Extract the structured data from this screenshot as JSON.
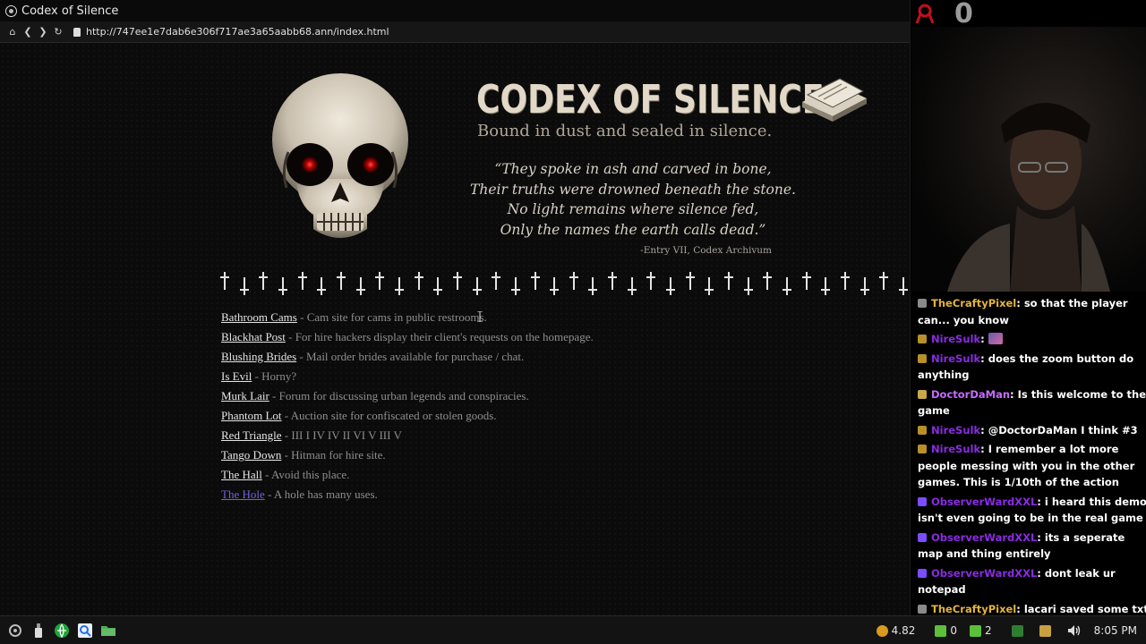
{
  "browser": {
    "window_title": "Codex of Silence",
    "url": "http://747ee1e7dab6e306f717ae3a65aabb68.ann/index.html",
    "nav_icons": [
      "home-icon",
      "back-icon",
      "forward-icon",
      "reload-icon"
    ]
  },
  "page": {
    "title": "CODEX OF SILENCE",
    "subtitle": "Bound in dust and sealed in silence.",
    "poem": [
      "“They spoke in ash and carved in bone,",
      "Their truths were drowned beneath the stone.",
      "No light remains where silence fed,",
      "Only the names the earth calls dead.”"
    ],
    "attribution": "-Entry VII, Codex Archivum",
    "divider_crosses": 36,
    "sites": [
      {
        "name": "Bathroom Cams",
        "desc": " - Cam site for cams in public restrooms.",
        "visited": false
      },
      {
        "name": "Blackhat Post",
        "desc": " - For hire hackers display their client's requests on the homepage.",
        "visited": false
      },
      {
        "name": "Blushing Brides",
        "desc": " - Mail order brides available for purchase / chat.",
        "visited": false
      },
      {
        "name": "Is Evil",
        "desc": " - Horny?",
        "visited": false
      },
      {
        "name": "Murk Lair",
        "desc": " - Forum for discussing urban legends and conspiracies.",
        "visited": false
      },
      {
        "name": "Phantom Lot",
        "desc": " - Auction site for confiscated or stolen goods.",
        "visited": false
      },
      {
        "name": "Red Triangle",
        "desc": " - III I IV IV II VI V III V",
        "visited": false
      },
      {
        "name": "Tango Down",
        "desc": " - Hitman for hire site.",
        "visited": false
      },
      {
        "name": "The Hall",
        "desc": " - Avoid this place.",
        "visited": false
      },
      {
        "name": "The Hole",
        "desc": " - A hole has many uses.",
        "visited": true
      }
    ]
  },
  "stream": {
    "follower_count": "0",
    "chat": [
      {
        "user": "TheCraftyPixel",
        "color": "#e3b33c",
        "badge": "gray",
        "text": ": so that the player can... you know"
      },
      {
        "user": "NireSulk",
        "color": "#8a2be2",
        "badge": "gold",
        "text": ": ",
        "emote": true
      },
      {
        "user": "NireSulk",
        "color": "#8a2be2",
        "badge": "gold",
        "text": ": does the zoom button do anything"
      },
      {
        "user": "DoctorDaMan",
        "color": "#c76bff",
        "badge": "yellow",
        "text": ": Is this welcome to the game"
      },
      {
        "user": "NireSulk",
        "color": "#8a2be2",
        "badge": "gold",
        "text": ": @DoctorDaMan I think #3"
      },
      {
        "user": "NireSulk",
        "color": "#8a2be2",
        "badge": "gold",
        "text": ": I remember a lot more people messing with you in the other games. This is 1/10th of the action"
      },
      {
        "user": "ObserverWardXXL",
        "color": "#8a2be2",
        "badge": "purple",
        "text": ": i heard this demo isn't even going to be in the real game"
      },
      {
        "user": "ObserverWardXXL",
        "color": "#8a2be2",
        "badge": "purple",
        "text": ": its a seperate map and thing entirely"
      },
      {
        "user": "ObserverWardXXL",
        "color": "#8a2be2",
        "badge": "purple",
        "text": ": dont leak ur notepad"
      },
      {
        "user": "TheCraftyPixel",
        "color": "#e3b33c",
        "badge": "gray",
        "text": ": lacari saved some txt files your pc"
      }
    ]
  },
  "taskbar": {
    "launcher_icons": [
      "start-menu-icon",
      "usb-icon",
      "globe-icon",
      "search-app-icon",
      "folder-icon"
    ],
    "tray": {
      "coin_value": "4.82",
      "alerts_count": "0",
      "network_count": "2",
      "time": "8:05 PM"
    }
  }
}
